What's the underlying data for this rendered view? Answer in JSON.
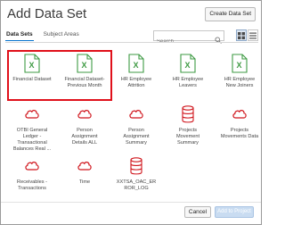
{
  "dialog": {
    "title": "Add Data Set",
    "create_button": "Create Data Set"
  },
  "tabs": [
    {
      "label": "Data Sets",
      "active": true
    },
    {
      "label": "Subject Areas",
      "active": false
    }
  ],
  "search": {
    "placeholder": "Search"
  },
  "view_toggle": {
    "selected": "grid"
  },
  "datasets": [
    {
      "label": "Financial Dataset",
      "icon": "excel-icon"
    },
    {
      "label": "Financial Dataset-\nPrevious Month",
      "icon": "excel-icon"
    },
    {
      "label": "HR Employee\nAttrition",
      "icon": "excel-icon"
    },
    {
      "label": "HR Employee\nLeavers",
      "icon": "excel-icon"
    },
    {
      "label": "HR Employee\nNew Joiners",
      "icon": "excel-icon"
    },
    {
      "label": "OTBI General\nLedger -\nTransactional\nBalances Real ...",
      "icon": "cloud-icon"
    },
    {
      "label": "Person\nAssignment\nDetails ALL",
      "icon": "cloud-icon"
    },
    {
      "label": "Person\nAssignment\nSummary",
      "icon": "cloud-icon"
    },
    {
      "label": "Projects\nMovement\nSummary",
      "icon": "database-icon"
    },
    {
      "label": "Projects\nMovements Data",
      "icon": "cloud-icon"
    },
    {
      "label": "Receivables -\nTransactions",
      "icon": "cloud-icon"
    },
    {
      "label": "Time",
      "icon": "cloud-icon"
    },
    {
      "label": "XXTSA_OAC_ER\nROR_LOG",
      "icon": "database-icon"
    }
  ],
  "footer": {
    "cancel": "Cancel",
    "add": "Add to Project"
  },
  "colors": {
    "excel_green": "#3e9a43",
    "cloud_red": "#d0161d",
    "highlight_red": "#e0101a",
    "accent_blue": "#0572ce"
  }
}
